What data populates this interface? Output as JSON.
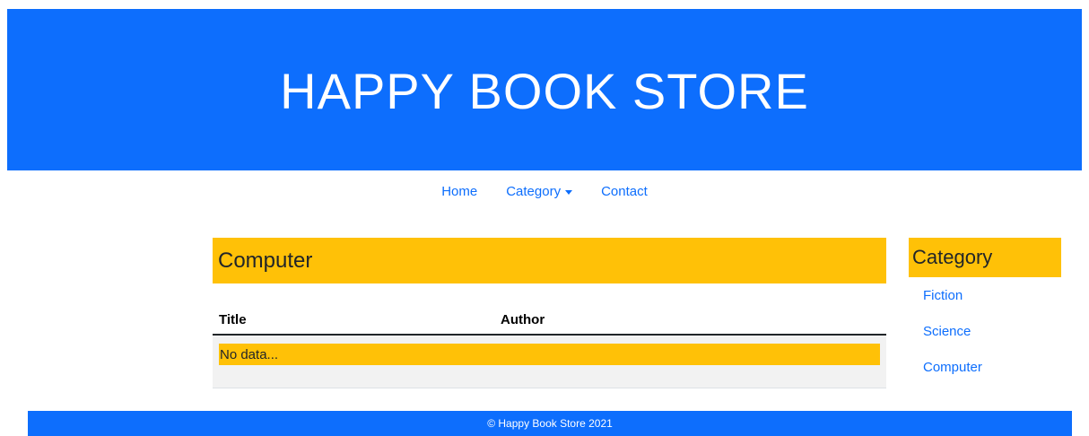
{
  "header": {
    "title": "HAPPY BOOK STORE"
  },
  "nav": {
    "items": [
      {
        "label": "Home"
      },
      {
        "label": "Category"
      },
      {
        "label": "Contact"
      }
    ]
  },
  "main": {
    "heading": "Computer",
    "table": {
      "columns": [
        "Title",
        "Author"
      ],
      "rows": [],
      "empty_text": "No data..."
    }
  },
  "sidebar": {
    "heading": "Category",
    "items": [
      {
        "label": "Fiction"
      },
      {
        "label": "Science"
      },
      {
        "label": "Computer"
      }
    ]
  },
  "footer": {
    "text": "© Happy Book Store 2021"
  },
  "colors": {
    "primary": "#0d6efd",
    "accent": "#ffc107",
    "table_body": "#f2f2f2"
  },
  "icons": {
    "dropdown": "caret-down-icon"
  }
}
